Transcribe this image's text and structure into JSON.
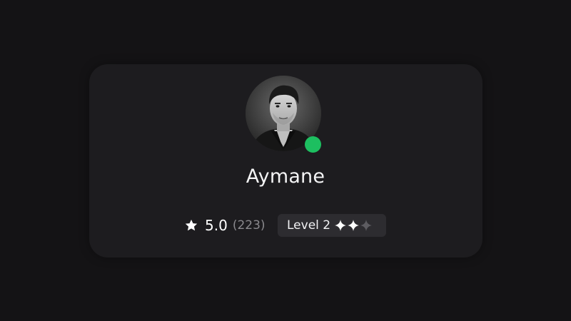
{
  "profile": {
    "name": "Aymane",
    "online": true,
    "status_color": "#1dbf60"
  },
  "rating": {
    "icon": "star-icon",
    "value": "5.0",
    "count": "(223)"
  },
  "level": {
    "label": "Level 2",
    "filled": 2,
    "total": 3,
    "filled_color": "#ffffff",
    "empty_color": "#5d5c61"
  }
}
